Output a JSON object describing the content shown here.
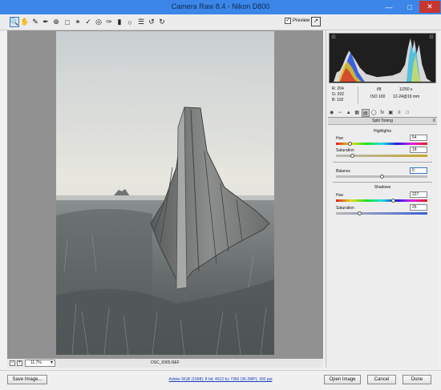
{
  "window": {
    "title": "Camera Raw 8.4  -  Nikon D800"
  },
  "toolbar": {
    "tools": [
      "zoom-tool",
      "hand-tool",
      "white-balance-tool",
      "color-sampler-tool",
      "targeted-adjustment-tool",
      "crop-tool",
      "straighten-tool",
      "spot-removal-tool",
      "red-eye-tool",
      "adjustment-brush",
      "graduated-filter",
      "radial-filter",
      "open-preferences",
      "rotate-ccw",
      "rotate-cw"
    ],
    "preview_label": "Preview",
    "preview_checked": "✓"
  },
  "status": {
    "zoom": "11.7%",
    "filename": "DSC_9365.NEF"
  },
  "readout": {
    "r": "R:  204",
    "g": "G:  202",
    "b": "B:  192",
    "aperture": "f/8",
    "shutter": "1/250 s",
    "iso": "ISO 100",
    "lens": "12-24@19 mm"
  },
  "panel": {
    "title": "Split Toning",
    "highlights": {
      "label": "Highlights",
      "hue_label": "Hue",
      "hue_value": "54",
      "hue_level": 54,
      "sat_label": "Saturation",
      "sat_value": "18",
      "sat_level": 18
    },
    "balance": {
      "label": "Balance",
      "value": "0",
      "level": 0
    },
    "shadows": {
      "label": "Shadows",
      "hue_label": "Hue",
      "hue_value": "227",
      "hue_level": 227,
      "sat_label": "Saturation",
      "sat_value": "26",
      "sat_level": 26
    }
  },
  "bottom": {
    "save_label": "Save Image...",
    "workflow_link": "Adobe RGB (1998); 8 bit; 4912 by 7360 (36.2MP); 300 ppi",
    "open_label": "Open Image",
    "cancel_label": "Cancel",
    "done_label": "Done"
  },
  "colors": {
    "titlebar": "#3b86e8",
    "canvas": "#919191",
    "close": "#c7372f"
  }
}
